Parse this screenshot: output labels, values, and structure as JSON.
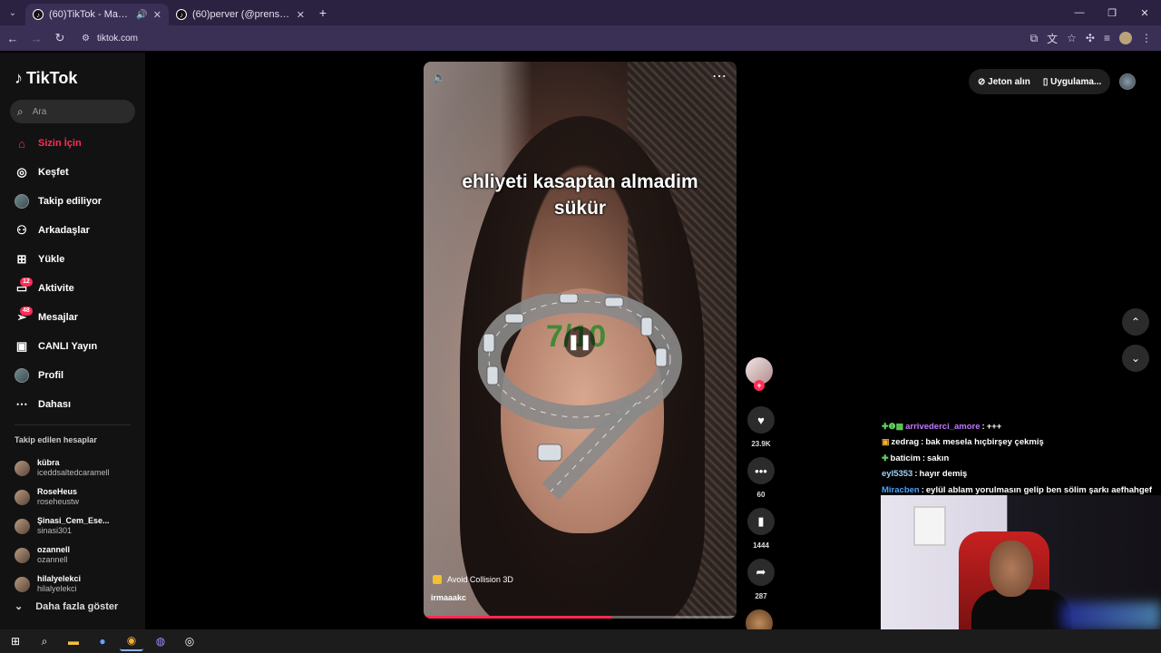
{
  "browser": {
    "tabs": [
      {
        "title": "(60)TikTok - Make Your Day",
        "active": true
      },
      {
        "title": "(60)perver (@prensesperver) | T",
        "active": false
      }
    ],
    "url": "tiktok.com"
  },
  "sidebar": {
    "logo": "TikTok",
    "search_placeholder": "Ara",
    "items": [
      {
        "label": "Sizin İçin",
        "icon": "home-icon",
        "active": true
      },
      {
        "label": "Keşfet",
        "icon": "compass-icon"
      },
      {
        "label": "Takip ediliyor",
        "icon": "avatar"
      },
      {
        "label": "Arkadaşlar",
        "icon": "friends-icon"
      },
      {
        "label": "Yükle",
        "icon": "plus-square-icon"
      },
      {
        "label": "Aktivite",
        "icon": "message-icon",
        "badge": "12"
      },
      {
        "label": "Mesajlar",
        "icon": "paper-plane-icon",
        "badge": "48"
      },
      {
        "label": "CANLI Yayın",
        "icon": "tv-icon"
      },
      {
        "label": "Profil",
        "icon": "avatar"
      },
      {
        "label": "Dahası",
        "icon": "more-icon"
      }
    ],
    "following_title": "Takip edilen hesaplar",
    "following": [
      {
        "name": "kübra",
        "username": "iceddsaltedcaramell"
      },
      {
        "name": "RoseHeus",
        "username": "roseheustw"
      },
      {
        "name": "Şinasi_Cem_Ese...",
        "username": "sinasi301"
      },
      {
        "name": "ozannell",
        "username": "ozannell"
      },
      {
        "name": "hilalyelekci",
        "username": "hilalyelekci"
      }
    ],
    "show_more": "Daha fazla göster"
  },
  "video": {
    "caption_line1": "ehliyeti kasaptan almadim",
    "caption_line2": "sükür",
    "score": "7/10",
    "game_tag": "Avoid Collision 3D",
    "author": "irmaaakc",
    "progress": 0.6
  },
  "actions": {
    "likes": "23.9K",
    "comments": "60",
    "saves": "1444",
    "shares": "287"
  },
  "header": {
    "coins": "Jeton alın",
    "app": "Uygulama..."
  },
  "chat": [
    {
      "user": "arrivederci_amore",
      "user_color": "#c478ff",
      "msg": "+++",
      "emotes": "✚❶▩"
    },
    {
      "user": "zedrag",
      "user_color": "#ffffff",
      "msg": "bak mesela hıçbirşey çekmiş",
      "emotes": "▣"
    },
    {
      "user": "baticim",
      "user_color": "#ffffff",
      "msg": "sakın",
      "emotes": "✚"
    },
    {
      "user": "eyl5353",
      "user_color": "#6ec6ff",
      "msg": "hayır demiş",
      "emotes": ""
    },
    {
      "user": "Miracben",
      "user_color": "#4aa3ff",
      "msg": "eylül ablam yorulmasın gelip ben sölim şarkı aefhahgef",
      "emotes": ""
    }
  ],
  "colors": {
    "accent": "#fe2c55",
    "browser_bg": "#2b2140"
  }
}
